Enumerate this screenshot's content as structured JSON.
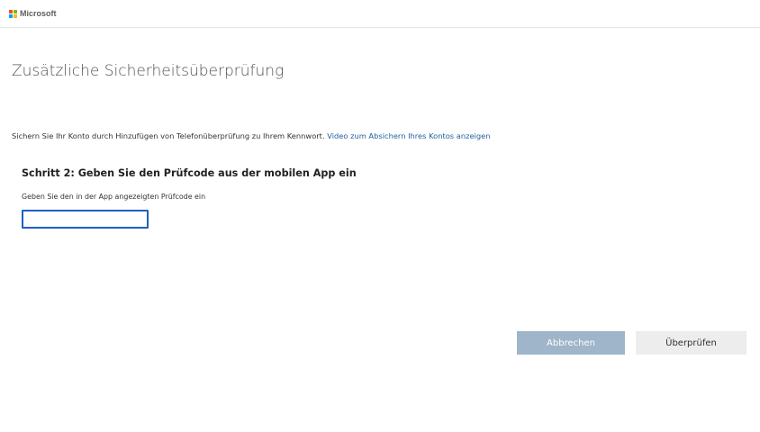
{
  "header": {
    "brand": "Microsoft",
    "brand_colors": [
      "#f25022",
      "#7fba00",
      "#00a4ef",
      "#ffb900"
    ]
  },
  "page": {
    "title": "Zusätzliche Sicherheitsüberprüfung",
    "intro_text": "Sichern Sie Ihr Konto durch Hinzufügen von Telefonüberprüfung zu Ihrem Kennwort. ",
    "intro_link": "Video zum Absichern Ihres Kontos anzeigen",
    "link_color": "#1f5e9e"
  },
  "step": {
    "title": "Schritt 2: Geben Sie den Prüfcode aus der mobilen App ein",
    "hint": "Geben Sie den in der App angezeigten Prüfcode ein",
    "code_value": ""
  },
  "actions": {
    "cancel_label": "Abbrechen",
    "verify_label": "Überprüfen",
    "cancel_color": "#9fb5c9",
    "focus_color": "#1c61c5"
  }
}
